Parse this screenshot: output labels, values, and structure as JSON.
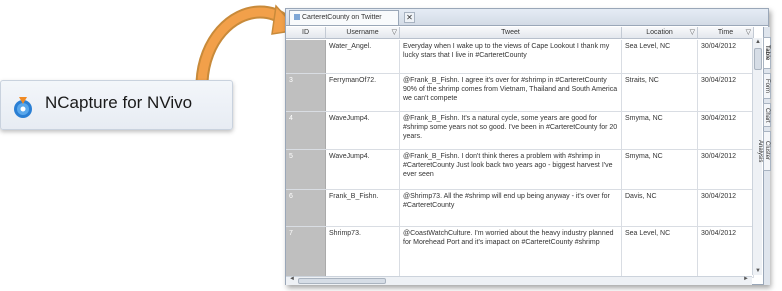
{
  "ncapture": {
    "label": "NCapture for NVivo"
  },
  "window": {
    "tab_label": "CarteretCounty on Twitter",
    "tab_close": "✕",
    "columns": {
      "id": "ID",
      "username": "Username",
      "tweet": "Tweet",
      "location": "Location",
      "time": "Time"
    },
    "filter_glyph": "▽",
    "rows": [
      {
        "id": "",
        "username": "Water_Angel.",
        "tweet": "Everyday when I wake up to the views of Cape Lookout I thank my lucky stars that I live in #CarteretCounty",
        "location": "Sea Level, NC",
        "time": "30/04/2012"
      },
      {
        "id": "3",
        "username": "FerrymanOf72.",
        "tweet": "@Frank_B_Fishn. I agree it's over for #shrimp in #CarteretCounty 90% of the shrimp comes from Vietnam, Thailand and South America we can't compete",
        "location": "Straits, NC",
        "time": "30/04/2012"
      },
      {
        "id": "4",
        "username": "WaveJump4.",
        "tweet": "@Frank_B_Fishn. It's a natural cycle, some years are good for #shrimp some years not so good. I've been in #CarteretCounty for 20 years.",
        "location": "Smyma, NC",
        "time": "30/04/2012"
      },
      {
        "id": "5",
        "username": "WaveJump4.",
        "tweet": "@Frank_B_Fishn. I don't think theres a problem with #shrimp in #CarteretCounty Just look back two years ago - biggest harvest I've ever seen",
        "location": "Smyma, NC",
        "time": "30/04/2012"
      },
      {
        "id": "6",
        "username": "Frank_B_Fishn.",
        "tweet": "@Shrimp73. All the #shrimp will end up being anyway - it's over for #CarteretCounty",
        "location": "Davis, NC",
        "time": "30/04/2012"
      },
      {
        "id": "7",
        "username": "Shrimp73.",
        "tweet": "@CoastWatchCulture. I'm worried about the heavy industry planned for Morehead Port and it's imapact on #CarteretCounty #shrimp",
        "location": "Sea Level, NC",
        "time": "30/04/2012"
      }
    ],
    "side_tabs": [
      "Table",
      "Form",
      "Chart",
      "Cluster Analysis"
    ]
  }
}
